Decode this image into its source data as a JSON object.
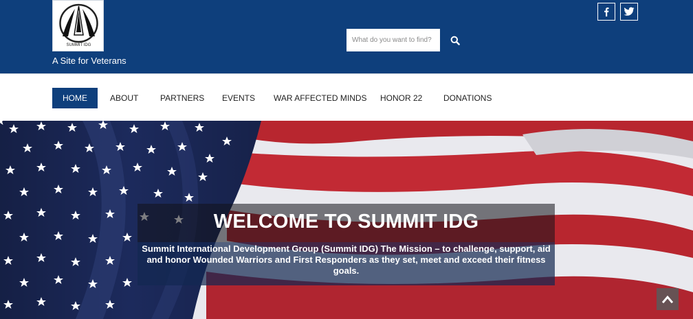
{
  "header": {
    "logo_text": "SUMMIT IDG",
    "tagline": "A Site for Veterans",
    "search": {
      "placeholder": "What do you want to find?",
      "value": ""
    },
    "social": [
      "facebook-icon",
      "twitter-icon"
    ]
  },
  "nav": {
    "items": [
      {
        "label": "HOME",
        "active": true
      },
      {
        "label": "ABOUT"
      },
      {
        "label": "PARTNERS"
      },
      {
        "label": "EVENTS"
      },
      {
        "label": "WAR AFFECTED MINDS"
      },
      {
        "label": "HONOR 22"
      },
      {
        "label": "DONATIONS"
      }
    ]
  },
  "hero": {
    "title": "WELCOME TO SUMMIT IDG",
    "text": "Summit International Development Group (Summit IDG) The Mission – to challenge, support, aid and honor Wounded Warriors and First Responders as they set, meet and exceed their fitness goals."
  },
  "colors": {
    "header_bg": "#0e3f7c",
    "nav_active_bg": "#0e3f7c",
    "flag_red": "#b8262f",
    "flag_blue": "#1c2a5c"
  }
}
